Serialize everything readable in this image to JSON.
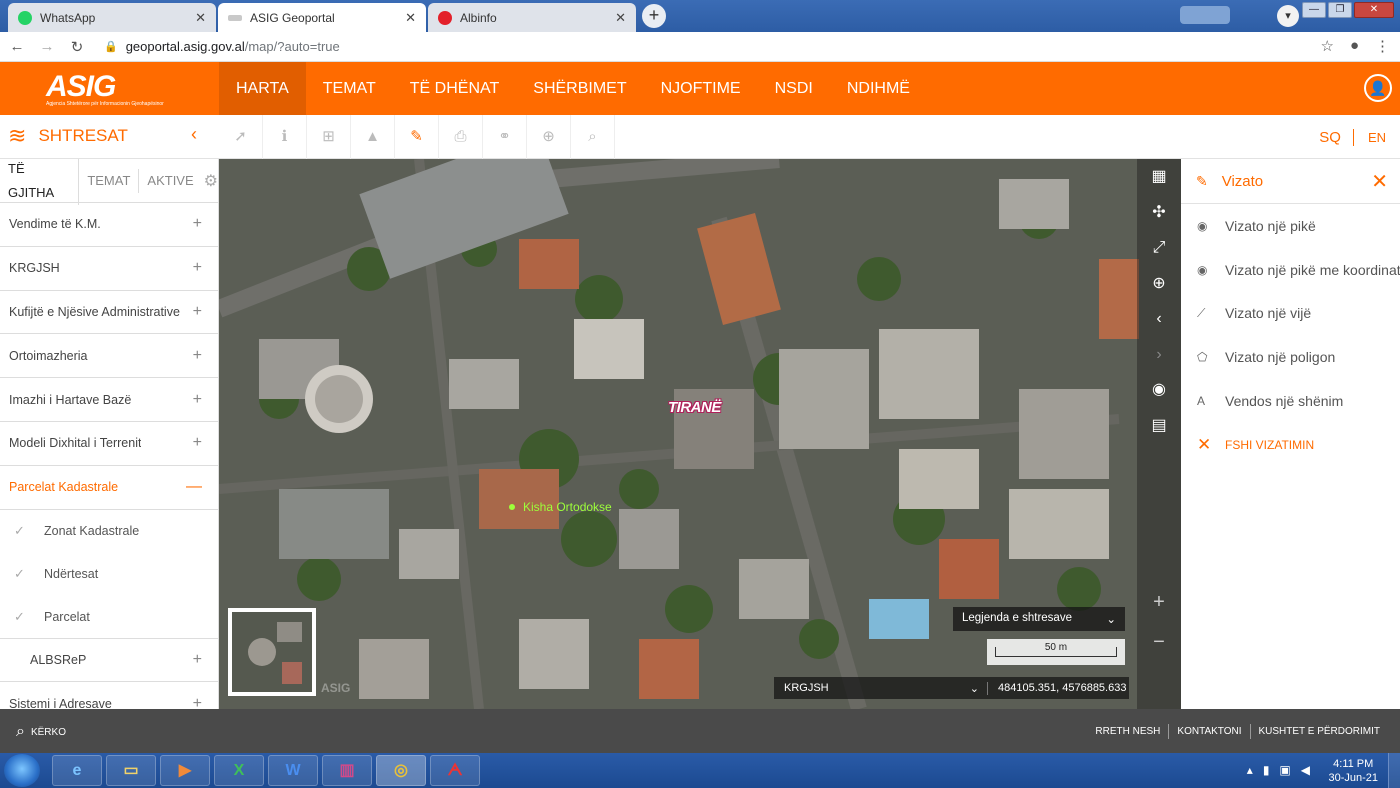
{
  "browser": {
    "tabs": [
      {
        "label": "WhatsApp",
        "color": "#25d366"
      },
      {
        "label": "ASIG Geoportal",
        "color": "#c9c9c9"
      },
      {
        "label": "Albinfo",
        "color": "#e3202a"
      }
    ],
    "url_host": "geoportal.asig.gov.al",
    "url_path": "/map/?auto=true"
  },
  "app": {
    "logo": "ASIG",
    "logo_sub": "Agjencia Shtetërore për Informacionin Gjeohapësinor",
    "nav": [
      "HARTA",
      "TEMAT",
      "TË DHËNAT",
      "SHËRBIMET",
      "NJOFTIME",
      "NSDI",
      "NDIHMË"
    ],
    "accent": "#ff6b00"
  },
  "toolbar": {
    "layers_title": "SHTRESAT",
    "lang_sq": "SQ",
    "lang_en": "EN"
  },
  "sidebar": {
    "tabs": [
      "TË GJITHA",
      "TEMAT",
      "AKTIVE"
    ],
    "layers": [
      "Vendime të K.M.",
      "KRGJSH",
      "Kufijtë e Njësive Administrative",
      "Ortoimazheria",
      "Imazhi i Hartave Bazë",
      "Modeli Dixhital i Terrenit",
      "Parcelat Kadastrale"
    ],
    "sublayers": [
      "Zonat Kadastrale",
      "Ndërtesat",
      "Parcelat"
    ],
    "after": [
      "ALBSReP",
      "Sistemi i Adresave"
    ]
  },
  "map": {
    "label_city": "TIRANË",
    "label_poi": "Kisha Ortodokse",
    "legend": "Legjenda e shtresave",
    "scale": "50 m",
    "crs": "KRGJSH",
    "coords": "484105.351, 4576885.633",
    "watermark": "ASIG"
  },
  "draw": {
    "title": "Vizato",
    "items": [
      {
        "label": "Vizato një pikë",
        "icon": "point-icon"
      },
      {
        "label": "Vizato një pikë me koordinata",
        "icon": "point-coords-icon"
      },
      {
        "label": "Vizato një vijë",
        "icon": "line-icon"
      },
      {
        "label": "Vizato një poligon",
        "icon": "polygon-icon"
      },
      {
        "label": "Vendos një shënim",
        "icon": "text-icon"
      }
    ],
    "clear": "FSHI VIZATIMIN"
  },
  "footer": {
    "search": "KËRKO",
    "links": [
      "RRETH NESH",
      "KONTAKTONI",
      "KUSHTET E PËRDORIMIT"
    ]
  },
  "taskbar": {
    "time": "4:11 PM",
    "date": "30-Jun-21"
  }
}
